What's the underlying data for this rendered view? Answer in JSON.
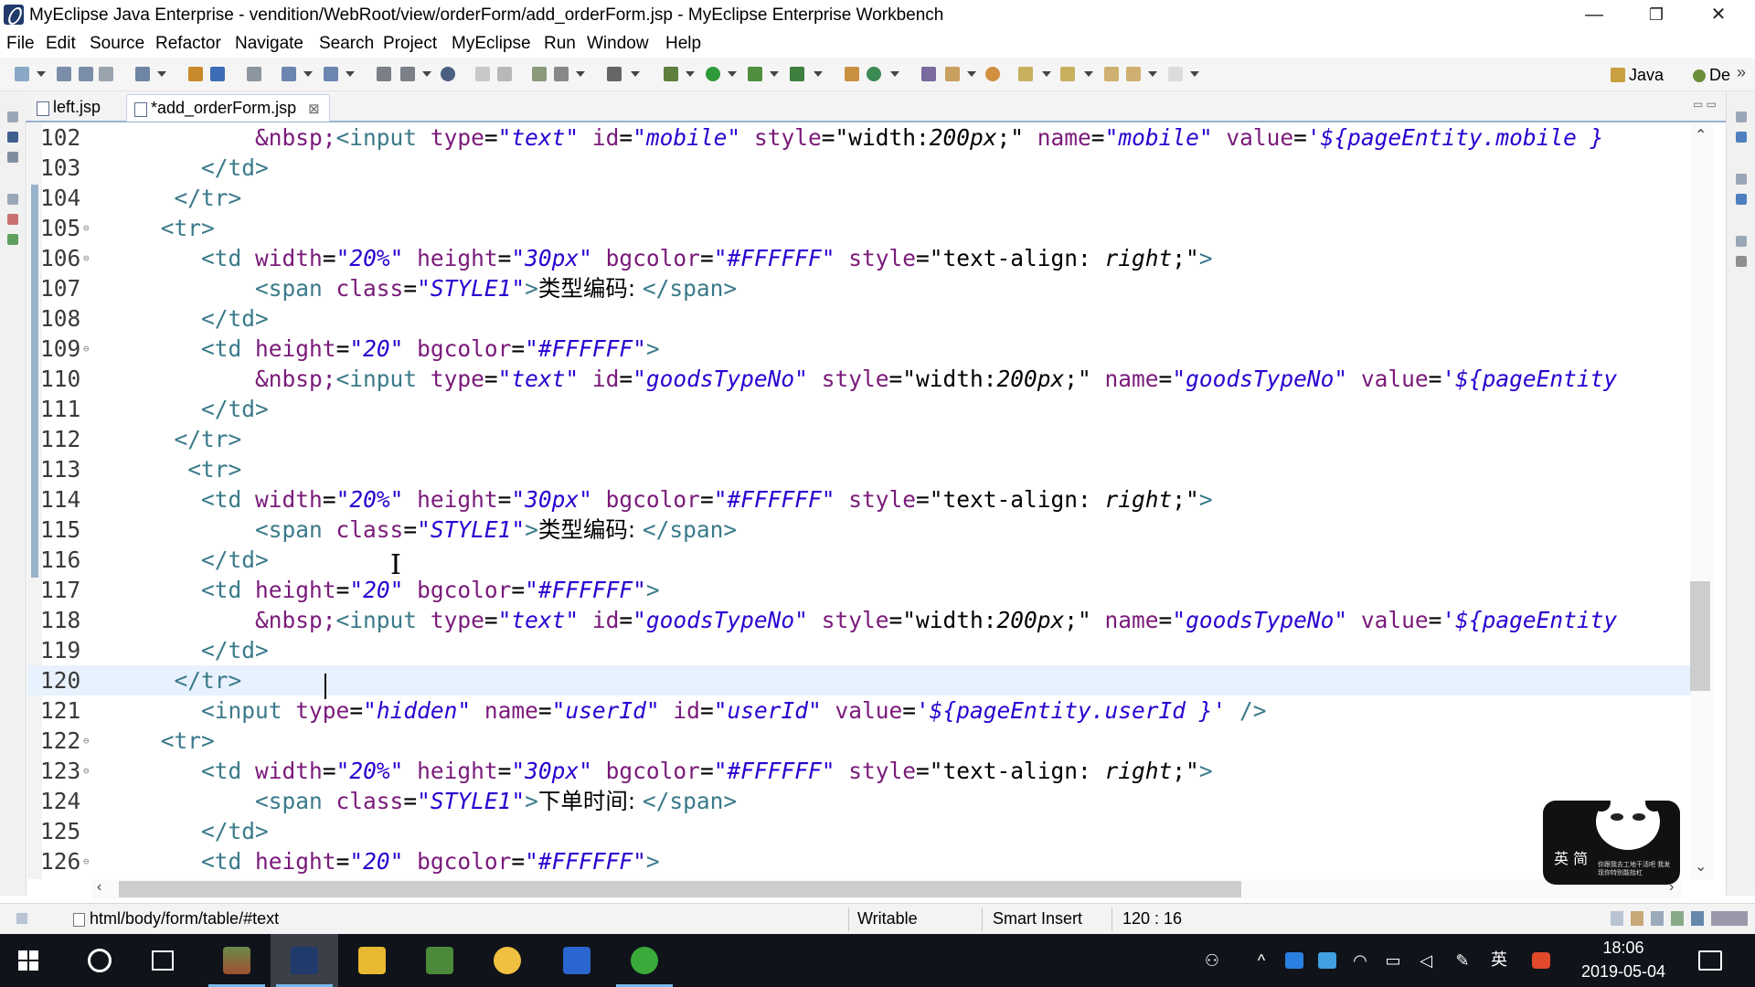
{
  "window": {
    "title": "MyEclipse Java Enterprise - vendition/WebRoot/view/orderForm/add_orderForm.jsp - MyEclipse Enterprise Workbench",
    "minimize": "—",
    "maximize": "❐",
    "close": "✕"
  },
  "menu": {
    "items": [
      "File",
      "Edit",
      "Source",
      "Refactor",
      "Navigate",
      "Search",
      "Project",
      "MyEclipse",
      "Run",
      "Window",
      "Help"
    ]
  },
  "toolbar": {
    "perspective_java": "Java",
    "perspective_debug": "De",
    "more": "»"
  },
  "tabs": [
    {
      "label": "left.jsp"
    },
    {
      "label": "*add_orderForm.jsp",
      "close": "⊠"
    }
  ],
  "editor": {
    "current_line": "120",
    "lines": [
      {
        "n": "102",
        "text": "            &nbsp;<input type=\"text\" id=\"mobile\" style=\"width:200px;\" name=\"mobile\" value='${pageEntity.mobile }"
      },
      {
        "n": "103",
        "text": "        </td>"
      },
      {
        "n": "104",
        "text": "      </tr>"
      },
      {
        "n": "105",
        "text": "     <tr>"
      },
      {
        "n": "106",
        "text": "        <td width=\"20%\" height=\"30px\" bgcolor=\"#FFFFFF\" style=\"text-align: right;\">"
      },
      {
        "n": "107",
        "text": "            <span class=\"STYLE1\">类型编码: </span>"
      },
      {
        "n": "108",
        "text": "        </td>"
      },
      {
        "n": "109",
        "text": "        <td height=\"20\" bgcolor=\"#FFFFFF\">"
      },
      {
        "n": "110",
        "text": "            &nbsp;<input type=\"text\" id=\"goodsTypeNo\" style=\"width:200px;\" name=\"goodsTypeNo\" value='${pageEntity"
      },
      {
        "n": "111",
        "text": "        </td>"
      },
      {
        "n": "112",
        "text": "      </tr>"
      },
      {
        "n": "113",
        "text": "       <tr>"
      },
      {
        "n": "114",
        "text": "        <td width=\"20%\" height=\"30px\" bgcolor=\"#FFFFFF\" style=\"text-align: right;\">"
      },
      {
        "n": "115",
        "text": "            <span class=\"STYLE1\">类型编码: </span>"
      },
      {
        "n": "116",
        "text": "        </td>"
      },
      {
        "n": "117",
        "text": "        <td height=\"20\" bgcolor=\"#FFFFFF\">"
      },
      {
        "n": "118",
        "text": "            &nbsp;<input type=\"text\" id=\"goodsTypeNo\" style=\"width:200px;\" name=\"goodsTypeNo\" value='${pageEntity"
      },
      {
        "n": "119",
        "text": "        </td>"
      },
      {
        "n": "120",
        "text": "      </tr>"
      },
      {
        "n": "121",
        "text": "        <input type=\"hidden\" name=\"userId\" id=\"userId\" value='${pageEntity.userId }' />"
      },
      {
        "n": "122",
        "text": "     <tr>"
      },
      {
        "n": "123",
        "text": "        <td width=\"20%\" height=\"30px\" bgcolor=\"#FFFFFF\" style=\"text-align: right;\">"
      },
      {
        "n": "124",
        "text": "            <span class=\"STYLE1\">下单时间: </span>"
      },
      {
        "n": "125",
        "text": "        </td>"
      },
      {
        "n": "126",
        "text": "        <td height=\"20\" bgcolor=\"#FFFFFF\">"
      }
    ]
  },
  "sticker": {
    "label": "英 简",
    "caption": "你跟我去工地干活吧 我发现你特别能抬杠"
  },
  "status": {
    "path": "html/body/form/table/#text",
    "mode": "Writable",
    "insert": "Smart Insert",
    "position": "120 : 16"
  },
  "taskbar": {
    "ime": "英",
    "time": "18:06",
    "date": "2019-05-04"
  },
  "colors": {
    "tag": "#3a7a8a",
    "attribute": "#7a1a7a",
    "value": "#2a00d0",
    "current_line": "#e8f2fe",
    "taskbar": "#10131a"
  }
}
